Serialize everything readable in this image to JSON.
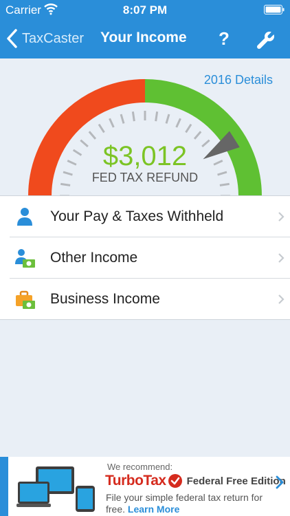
{
  "status_bar": {
    "carrier": "Carrier",
    "time": "8:07 PM"
  },
  "nav": {
    "back_label": "TaxCaster",
    "title": "Your Income",
    "help_label": "?"
  },
  "details_link": "2016 Details",
  "gauge": {
    "amount": "$3,012",
    "label": "FED TAX REFUND",
    "needle_level": 0.82,
    "colors": {
      "low": "#f04a1d",
      "high": "#5fc033",
      "amount": "#7cc425",
      "needle": "#666666"
    }
  },
  "menu": {
    "items": [
      {
        "label": "Your Pay & Taxes Withheld",
        "icon": "person-icon"
      },
      {
        "label": "Other Income",
        "icon": "person-money-icon"
      },
      {
        "label": "Business Income",
        "icon": "briefcase-money-icon"
      }
    ]
  },
  "ad": {
    "recommend": "We recommend:",
    "brand": "TurboTax",
    "edition": "Federal Free Edition",
    "tagline": "File your simple federal tax return for free.",
    "cta": "Learn More",
    "colors": {
      "brand": "#d52b1e",
      "accent": "#2a8ed9"
    }
  },
  "colors": {
    "primary": "#2a8ed9",
    "background": "#e9eff6"
  }
}
